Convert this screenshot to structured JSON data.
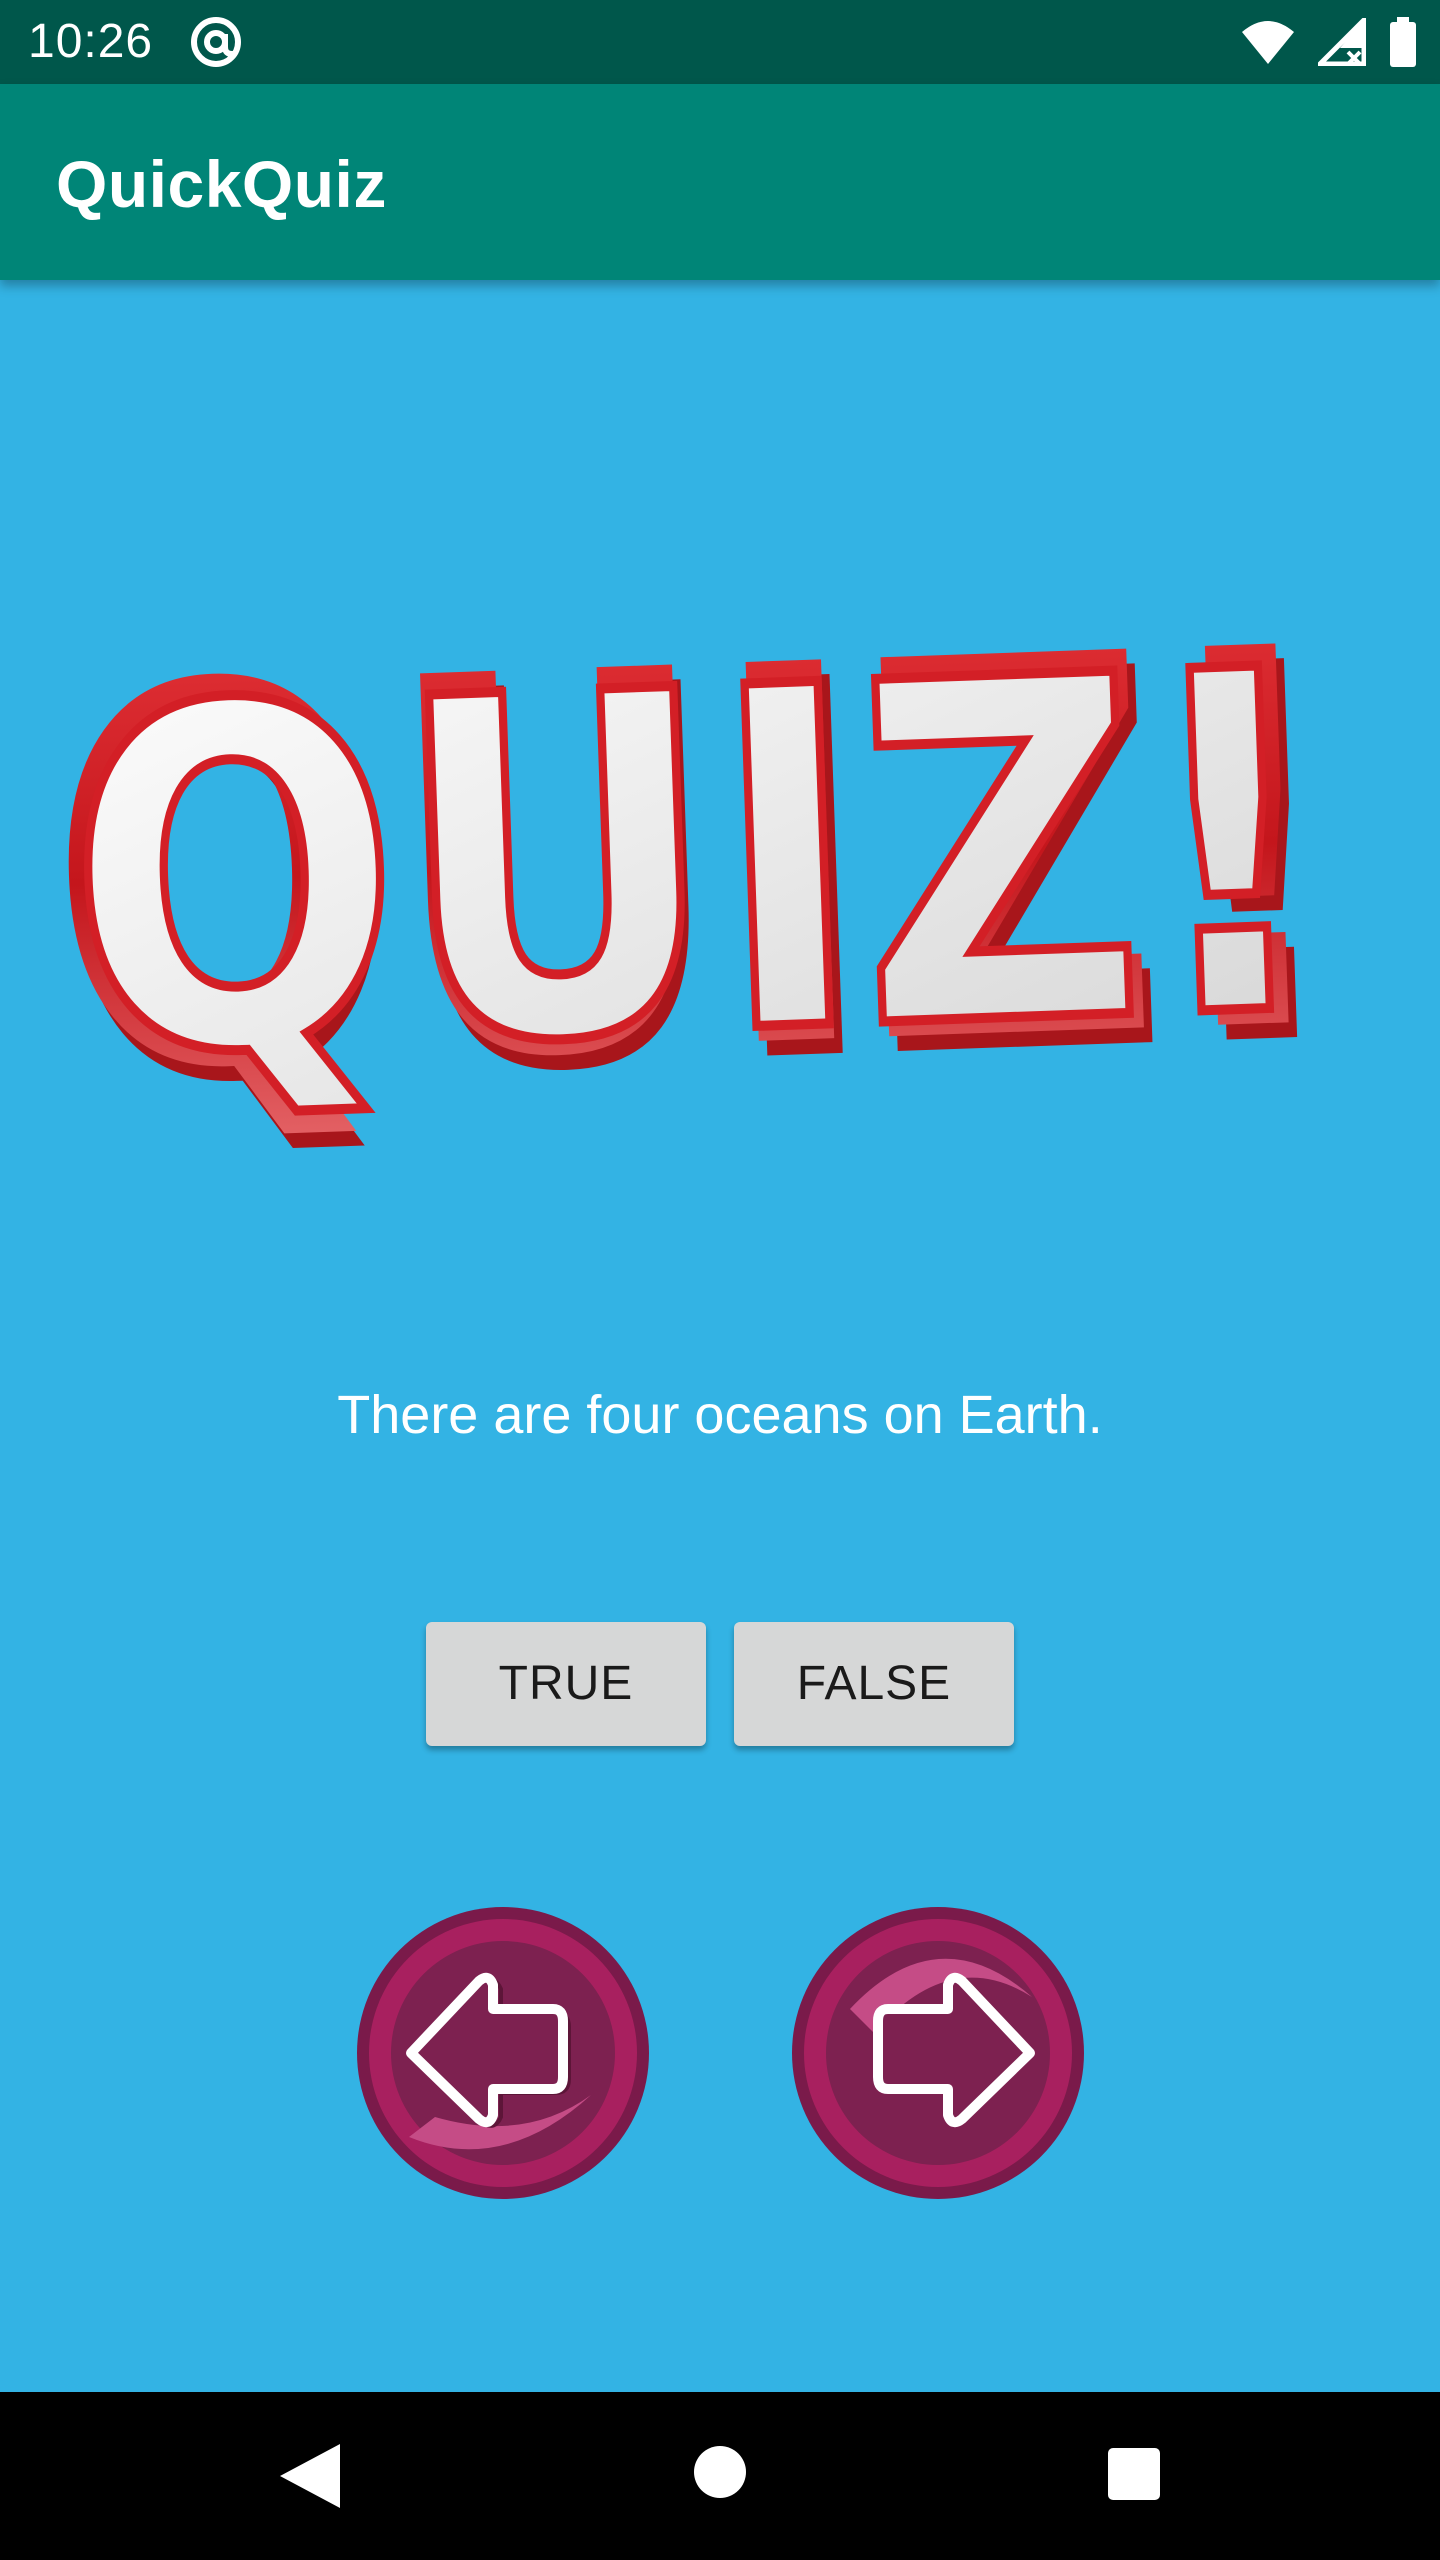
{
  "status_bar": {
    "time": "10:26",
    "icons": [
      "at-sign-icon",
      "wifi-icon",
      "signal-icon",
      "battery-icon"
    ]
  },
  "app_bar": {
    "title": "QuickQuiz",
    "color": "#008577"
  },
  "logo": {
    "text": "QUIZ!",
    "icon": "quiz-logo-image"
  },
  "question": {
    "text": "There are four oceans on Earth."
  },
  "answers": {
    "true_label": "TRUE",
    "false_label": "FALSE"
  },
  "navigation": {
    "prev_icon": "arrow-left-icon",
    "next_icon": "arrow-right-icon"
  },
  "system_nav": {
    "icons": [
      "back-icon",
      "home-icon",
      "recent-apps-icon"
    ]
  },
  "colors": {
    "background": "#33b3e4",
    "status_bar": "#00574b",
    "button": "#d6d7d7",
    "arrow_button": "#a11f5e",
    "logo_red": "#d31f26"
  }
}
